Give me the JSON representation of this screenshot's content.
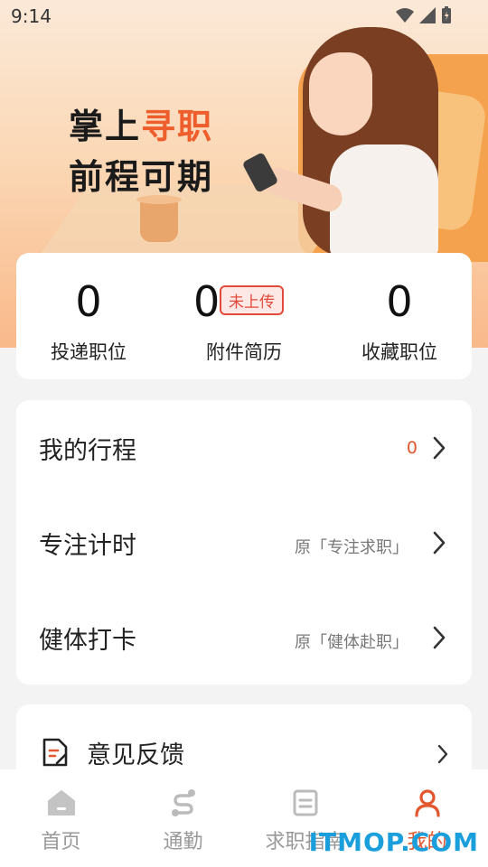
{
  "status_bar": {
    "time": "9:14"
  },
  "hero": {
    "line1_prefix": "掌上",
    "line1_highlight": "寻职",
    "line2": "前程可期"
  },
  "stats": [
    {
      "value": "0",
      "label": "投递职位"
    },
    {
      "value": "0",
      "label": "附件简历",
      "badge": "未上传"
    },
    {
      "value": "0",
      "label": "收藏职位"
    }
  ],
  "menu": [
    {
      "title": "我的行程",
      "count": "0"
    },
    {
      "title": "专注计时",
      "sub": "原「专注求职」"
    },
    {
      "title": "健体打卡",
      "sub": "原「健体赴职」"
    }
  ],
  "feedback": {
    "title": "意见反馈"
  },
  "nav": [
    {
      "label": "首页",
      "icon": "home-icon"
    },
    {
      "label": "通勤",
      "icon": "route-icon"
    },
    {
      "label": "求职指南",
      "icon": "guide-icon"
    },
    {
      "label": "我的",
      "icon": "user-icon",
      "active": true
    }
  ],
  "watermark": "ITMOP.COM",
  "colors": {
    "accent": "#e2572d",
    "badge": "#e24b3b"
  }
}
